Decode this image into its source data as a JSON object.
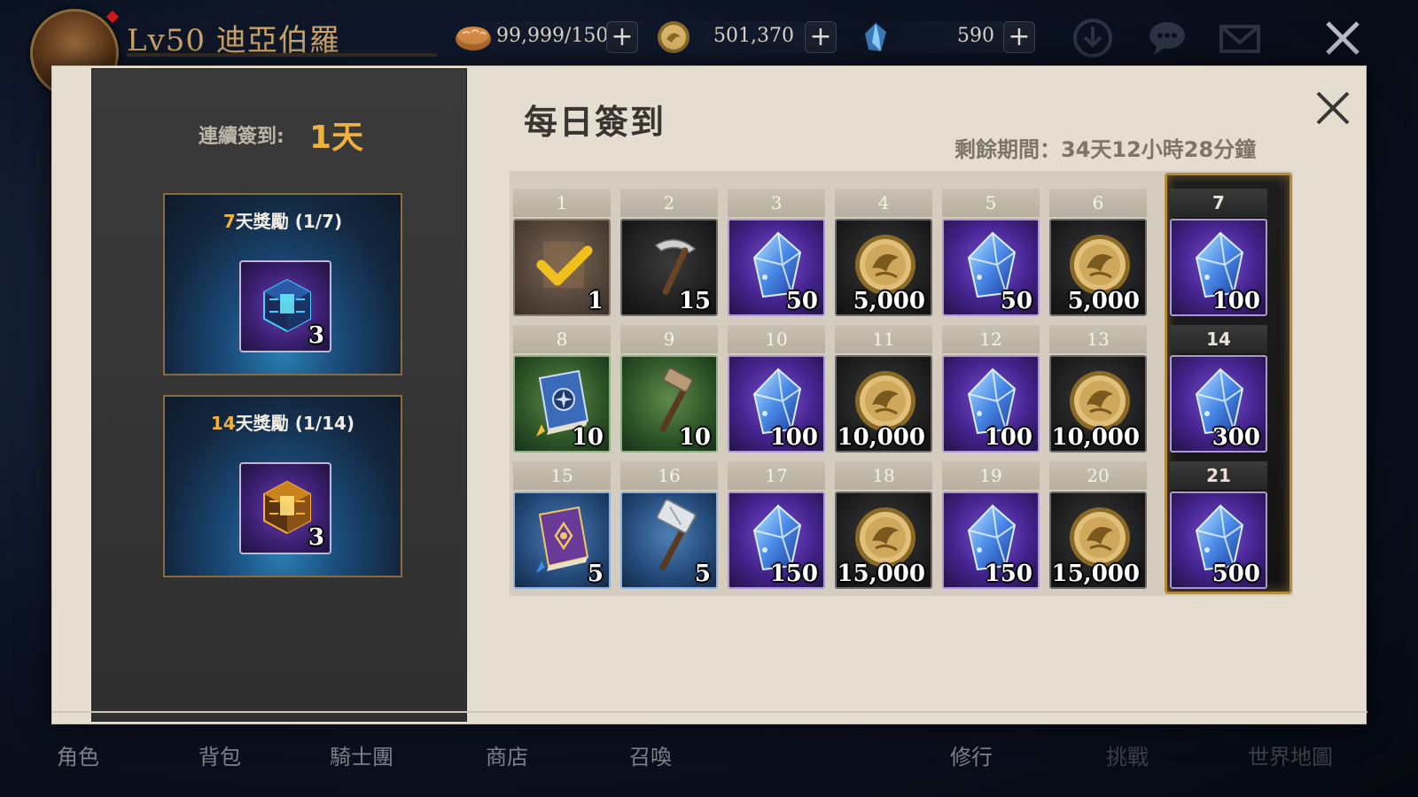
{
  "hud": {
    "player_name": "Lv50 迪亞伯羅",
    "resources": [
      {
        "name": "stamina",
        "icon": "bread-icon",
        "value": "99,999/150"
      },
      {
        "name": "gold",
        "icon": "gold-coin-icon",
        "value": "501,370"
      },
      {
        "name": "gem",
        "icon": "crystal-icon",
        "value": "590"
      }
    ],
    "plus_label": "+"
  },
  "bottom_nav": [
    "角色",
    "背包",
    "騎士團",
    "商店",
    "召喚",
    "修行",
    "挑戰",
    "世界地圖"
  ],
  "left_panel": {
    "streak_label": "連續簽到:",
    "streak_value": "1天",
    "milestones": [
      {
        "days": "7",
        "title_rest": "天獎勵 (1/7)",
        "qty": "3",
        "icon": "blue-cube-icon",
        "color": "#3fd0ff"
      },
      {
        "days": "14",
        "title_rest": "天獎勵 (1/14)",
        "qty": "3",
        "icon": "gold-cube-icon",
        "color": "#ffb028"
      }
    ]
  },
  "modal": {
    "title": "每日簽到",
    "remaining": "剩餘期間：34天12小時28分鐘"
  },
  "calendar": {
    "days": [
      {
        "day": "1",
        "item": "claimed-check-icon",
        "qty": "1",
        "bg": "brown",
        "claimed": true
      },
      {
        "day": "2",
        "item": "pickaxe-icon",
        "qty": "15",
        "bg": "dark"
      },
      {
        "day": "3",
        "item": "crystal-icon",
        "qty": "50",
        "bg": "purple"
      },
      {
        "day": "4",
        "item": "gold-coin-icon",
        "qty": "5,000",
        "bg": "dark"
      },
      {
        "day": "5",
        "item": "crystal-icon",
        "qty": "50",
        "bg": "purple"
      },
      {
        "day": "6",
        "item": "gold-coin-icon",
        "qty": "5,000",
        "bg": "dark"
      },
      {
        "day": "7",
        "item": "crystal-icon",
        "qty": "100",
        "bg": "purple",
        "gold": true
      },
      {
        "day": "8",
        "item": "blue-book-icon",
        "qty": "10",
        "bg": "green"
      },
      {
        "day": "9",
        "item": "hammer-icon",
        "qty": "10",
        "bg": "green"
      },
      {
        "day": "10",
        "item": "crystal-icon",
        "qty": "100",
        "bg": "purple"
      },
      {
        "day": "11",
        "item": "gold-coin-icon",
        "qty": "10,000",
        "bg": "dark"
      },
      {
        "day": "12",
        "item": "crystal-icon",
        "qty": "100",
        "bg": "purple"
      },
      {
        "day": "13",
        "item": "gold-coin-icon",
        "qty": "10,000",
        "bg": "dark"
      },
      {
        "day": "14",
        "item": "crystal-icon",
        "qty": "300",
        "bg": "purple",
        "gold": true
      },
      {
        "day": "15",
        "item": "purple-book-icon",
        "qty": "5",
        "bg": "blue"
      },
      {
        "day": "16",
        "item": "war-hammer-icon",
        "qty": "5",
        "bg": "blue"
      },
      {
        "day": "17",
        "item": "crystal-icon",
        "qty": "150",
        "bg": "purple"
      },
      {
        "day": "18",
        "item": "gold-coin-icon",
        "qty": "15,000",
        "bg": "dark"
      },
      {
        "day": "19",
        "item": "crystal-icon",
        "qty": "150",
        "bg": "purple"
      },
      {
        "day": "20",
        "item": "gold-coin-icon",
        "qty": "15,000",
        "bg": "dark"
      },
      {
        "day": "21",
        "item": "crystal-icon",
        "qty": "500",
        "bg": "purple",
        "gold": true
      }
    ]
  }
}
